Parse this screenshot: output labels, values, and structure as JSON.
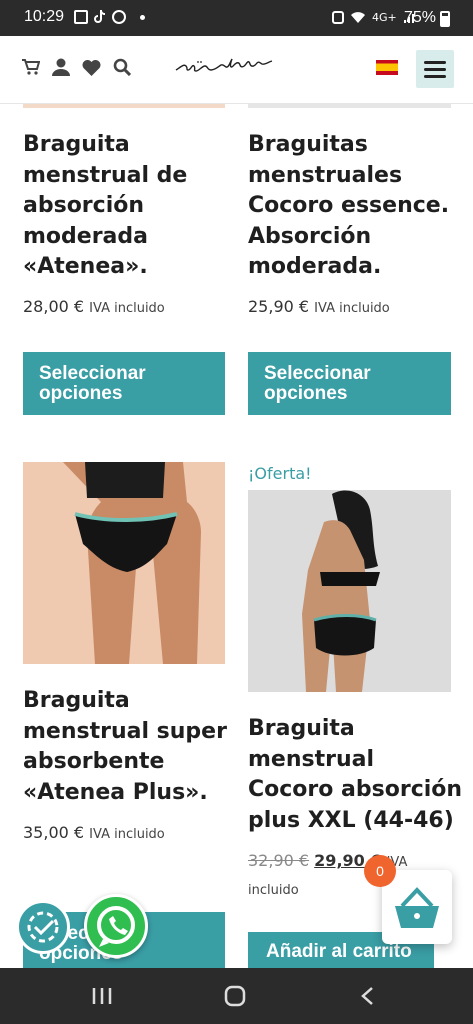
{
  "status_bar": {
    "time": "10:29",
    "network": "4G+",
    "battery": "75%"
  },
  "header": {
    "logo": "müshu",
    "icons": [
      "cart-icon",
      "user-icon",
      "heart-icon",
      "search-icon"
    ],
    "language_flag": "es-flag-icon",
    "menu_icon": "hamburger-menu-icon"
  },
  "products": [
    {
      "title_lines": [
        "Braguita",
        "menstrual de",
        "absorción",
        "moderada",
        "«Atenea»."
      ],
      "price": "28,00 €",
      "tax_note": "IVA incluido",
      "button_lines": [
        "Seleccionar",
        "opciones"
      ]
    },
    {
      "title_lines": [
        "Braguitas",
        "menstruales",
        "Cocoro essence.",
        "Absorción",
        "moderada."
      ],
      "price": "25,90 €",
      "tax_note": "IVA incluido",
      "button_lines": [
        "Seleccionar",
        "opciones"
      ]
    },
    {
      "title_lines": [
        "Braguita",
        "menstrual super",
        "absorbente",
        "«Atenea Plus»."
      ],
      "price": "35,00 €",
      "tax_note": "IVA incluido",
      "button_lines": [
        "Seleccionar",
        "opciones"
      ]
    },
    {
      "badge": "¡Oferta!",
      "title_lines": [
        "Braguita",
        "menstrual",
        "Cocoro absorción",
        "plus XXL (44-46)"
      ],
      "old_price": "32,90 €",
      "price": "29,90 €",
      "tax_note_a": "IVA",
      "tax_note_b": "incluido",
      "button": "Añadir al carrito"
    }
  ],
  "floating": {
    "cart_count": "0"
  },
  "colors": {
    "accent": "#3a9ea5",
    "badge": "#f0642d",
    "whatsapp": "#2fbe4f"
  }
}
